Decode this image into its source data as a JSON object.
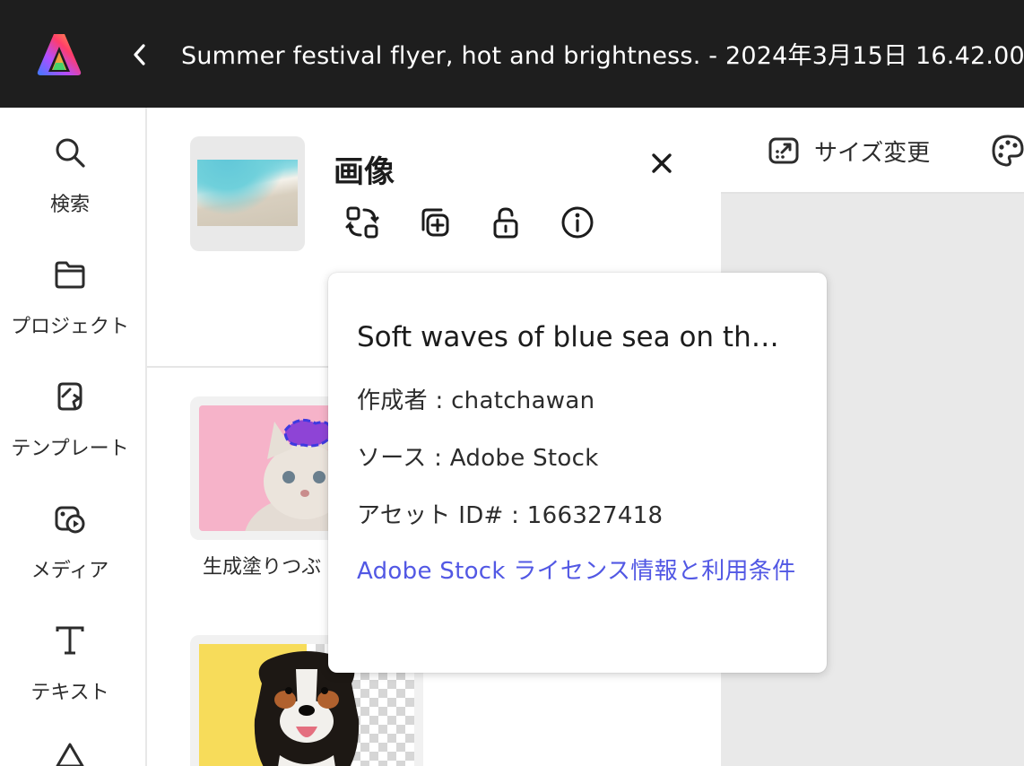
{
  "header": {
    "logo_icon": "adobe-express-logo",
    "back_icon": "chevron-left-icon",
    "document_title": "Summer festival flyer, hot and brightness. - 2024年3月15日 16.42.00"
  },
  "sidebar": {
    "items": [
      {
        "icon": "search-icon",
        "label": "検索"
      },
      {
        "icon": "folder-icon",
        "label": "プロジェクト"
      },
      {
        "icon": "template-icon",
        "label": "テンプレート"
      },
      {
        "icon": "media-icon",
        "label": "メディア"
      },
      {
        "icon": "text-icon",
        "label": "テキスト"
      }
    ]
  },
  "panel": {
    "title": "画像",
    "close_icon": "close-icon",
    "actions": [
      {
        "icon": "replace-icon"
      },
      {
        "icon": "duplicate-icon"
      },
      {
        "icon": "unlock-icon"
      },
      {
        "icon": "info-icon"
      }
    ],
    "cards": [
      {
        "label": "生成塗りつぶ"
      }
    ]
  },
  "canvas_toolbar": {
    "resize_label": "サイズ変更",
    "resize_icon": "resize-icon",
    "palette_icon": "palette-icon"
  },
  "info_popover": {
    "title": "Soft waves of blue sea on th…",
    "author": "作成者 : chatchawan",
    "source": "ソース : Adobe Stock",
    "asset_id": "アセット ID# : 166327418",
    "license_link": "Adobe Stock ライセンス情報と利用条件"
  },
  "colors": {
    "titlebar_bg": "#1e1e1e",
    "link": "#5258e4",
    "canvas_bg": "#e9e9e9"
  }
}
